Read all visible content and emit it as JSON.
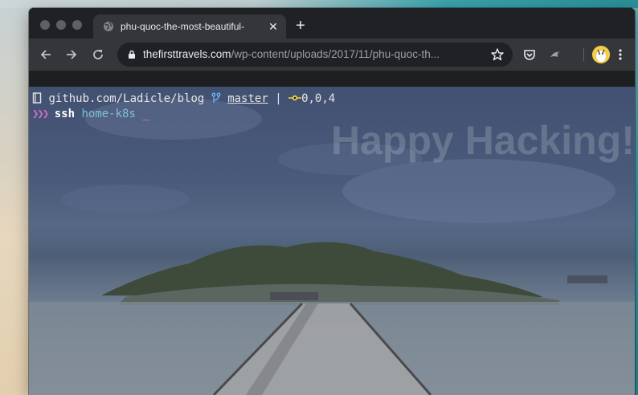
{
  "browser": {
    "tab": {
      "title": "phu-quoc-the-most-beautiful-",
      "favicon": "globe-icon",
      "close_glyph": "✕"
    },
    "new_tab_glyph": "+",
    "url_domain": "thefirsttravels.com",
    "url_path": "/wp-content/uploads/2017/11/phu-quoc-th...",
    "icons": [
      "back-arrow-icon",
      "forward-arrow-icon",
      "reload-icon",
      "lock-icon",
      "star-icon",
      "pocket-icon",
      "bird-extension-icon",
      "avatar-icon",
      "kebab-menu-icon"
    ]
  },
  "terminal": {
    "repo": "github.com/Ladicle/blog",
    "branch": "master",
    "separator": "|",
    "git_status": "0,0,4",
    "prompt": "❯❯❯",
    "command": "ssh",
    "argument": "home-k8s",
    "cursor": "_"
  },
  "overlay_text": "Happy Hacking!",
  "colors": {
    "prompt": "#cf6ec4",
    "argument": "#7cc2d8",
    "git_status_icon": "#f0d44a",
    "branch_icon": "#74b4ff"
  }
}
